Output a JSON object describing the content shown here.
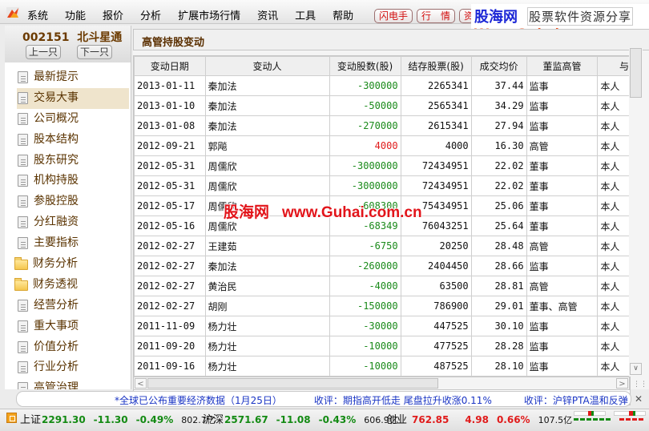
{
  "menu": {
    "items": [
      "系统",
      "功能",
      "报价",
      "分析",
      "扩展市场行情",
      "资讯",
      "工具",
      "帮助"
    ],
    "quick_buttons": [
      "闪电手",
      "行　情",
      "资"
    ]
  },
  "brand": {
    "name_cn": "股海网",
    "slogan": "股票软件资源分享",
    "url": "Www.Guhai.com.cn"
  },
  "stock": {
    "title": "002151  北斗星通",
    "prev_label": "上一只",
    "next_label": "下一只"
  },
  "sidebar": {
    "items": [
      {
        "label": "最新提示",
        "type": "doc"
      },
      {
        "label": "交易大事",
        "type": "doc",
        "active": true
      },
      {
        "label": "公司概况",
        "type": "doc"
      },
      {
        "label": "股本结构",
        "type": "doc"
      },
      {
        "label": "股东研究",
        "type": "doc"
      },
      {
        "label": "机构持股",
        "type": "doc"
      },
      {
        "label": "参股控股",
        "type": "doc"
      },
      {
        "label": "分红融资",
        "type": "doc"
      },
      {
        "label": "主要指标",
        "type": "doc"
      },
      {
        "label": "财务分析",
        "type": "folder"
      },
      {
        "label": "财务透视",
        "type": "folder"
      },
      {
        "label": "经营分析",
        "type": "doc"
      },
      {
        "label": "重大事项",
        "type": "doc"
      },
      {
        "label": "价值分析",
        "type": "doc"
      },
      {
        "label": "行业分析",
        "type": "doc"
      },
      {
        "label": "高管治理",
        "type": "doc"
      }
    ]
  },
  "section": {
    "title": "高管持股变动"
  },
  "table": {
    "headers": [
      "变动日期",
      "变动人",
      "变动股数(股)",
      "结存股票(股)",
      "成交均价",
      "董监高管",
      "与"
    ],
    "rows": [
      [
        "2013-01-11",
        "秦加法",
        "-300000",
        "2265341",
        "37.44",
        "监事",
        "本人"
      ],
      [
        "2013-01-10",
        "秦加法",
        "-50000",
        "2565341",
        "34.29",
        "监事",
        "本人"
      ],
      [
        "2013-01-08",
        "秦加法",
        "-270000",
        "2615341",
        "27.94",
        "监事",
        "本人"
      ],
      [
        "2012-09-21",
        "郭飚",
        "4000",
        "4000",
        "16.30",
        "高管",
        "本人"
      ],
      [
        "2012-05-31",
        "周儒欣",
        "-3000000",
        "72434951",
        "22.02",
        "董事",
        "本人"
      ],
      [
        "2012-05-31",
        "周儒欣",
        "-3000000",
        "72434951",
        "22.02",
        "董事",
        "本人"
      ],
      [
        "2012-05-17",
        "周儒欣",
        "-608300",
        "75434951",
        "25.06",
        "董事",
        "本人"
      ],
      [
        "2012-05-16",
        "周儒欣",
        "-68349",
        "76043251",
        "25.64",
        "董事",
        "本人"
      ],
      [
        "2012-02-27",
        "王建茹",
        "-6750",
        "20250",
        "28.48",
        "高管",
        "本人"
      ],
      [
        "2012-02-27",
        "秦加法",
        "-260000",
        "2404450",
        "28.66",
        "监事",
        "本人"
      ],
      [
        "2012-02-27",
        "黄治民",
        "-4000",
        "63500",
        "28.81",
        "高管",
        "本人"
      ],
      [
        "2012-02-27",
        "胡刚",
        "-150000",
        "786900",
        "29.01",
        "董事、高管",
        "本人"
      ],
      [
        "2011-11-09",
        "杨力壮",
        "-30000",
        "447525",
        "30.10",
        "监事",
        "本人"
      ],
      [
        "2011-09-20",
        "杨力壮",
        "-10000",
        "477525",
        "28.28",
        "监事",
        "本人"
      ],
      [
        "2011-09-16",
        "杨力壮",
        "-10000",
        "487525",
        "28.10",
        "监事",
        "本人"
      ]
    ]
  },
  "watermark": {
    "cn": "股海网",
    "url": "www.Guhai.com.cn"
  },
  "ticker": {
    "items": [
      "*全球已公布重要经济数据（1月25日）",
      "收评：期指高开低走 尾盘拉升收涨0.11%",
      "收评：沪锌PTA温和反弹"
    ]
  },
  "status": {
    "indices": [
      {
        "name": "上证",
        "value": "2291.30",
        "change": "-11.30",
        "pct": "-0.49%",
        "volume": "802.7亿",
        "trend": "down"
      },
      {
        "name": "沪深",
        "value": "2571.67",
        "change": "-11.08",
        "pct": "-0.43%",
        "volume": "606.9亿",
        "trend": "down"
      },
      {
        "name": "创业",
        "value": "762.85",
        "change": "4.98",
        "pct": "0.66%",
        "volume": "107.5亿",
        "trend": "up"
      }
    ]
  },
  "colors": {
    "up": "#e01b1b",
    "down": "#138a13",
    "ticker_text": "#1934c4",
    "sidebar_text": "#5a3300",
    "sidebar_active_bg": "#efe4cc"
  }
}
